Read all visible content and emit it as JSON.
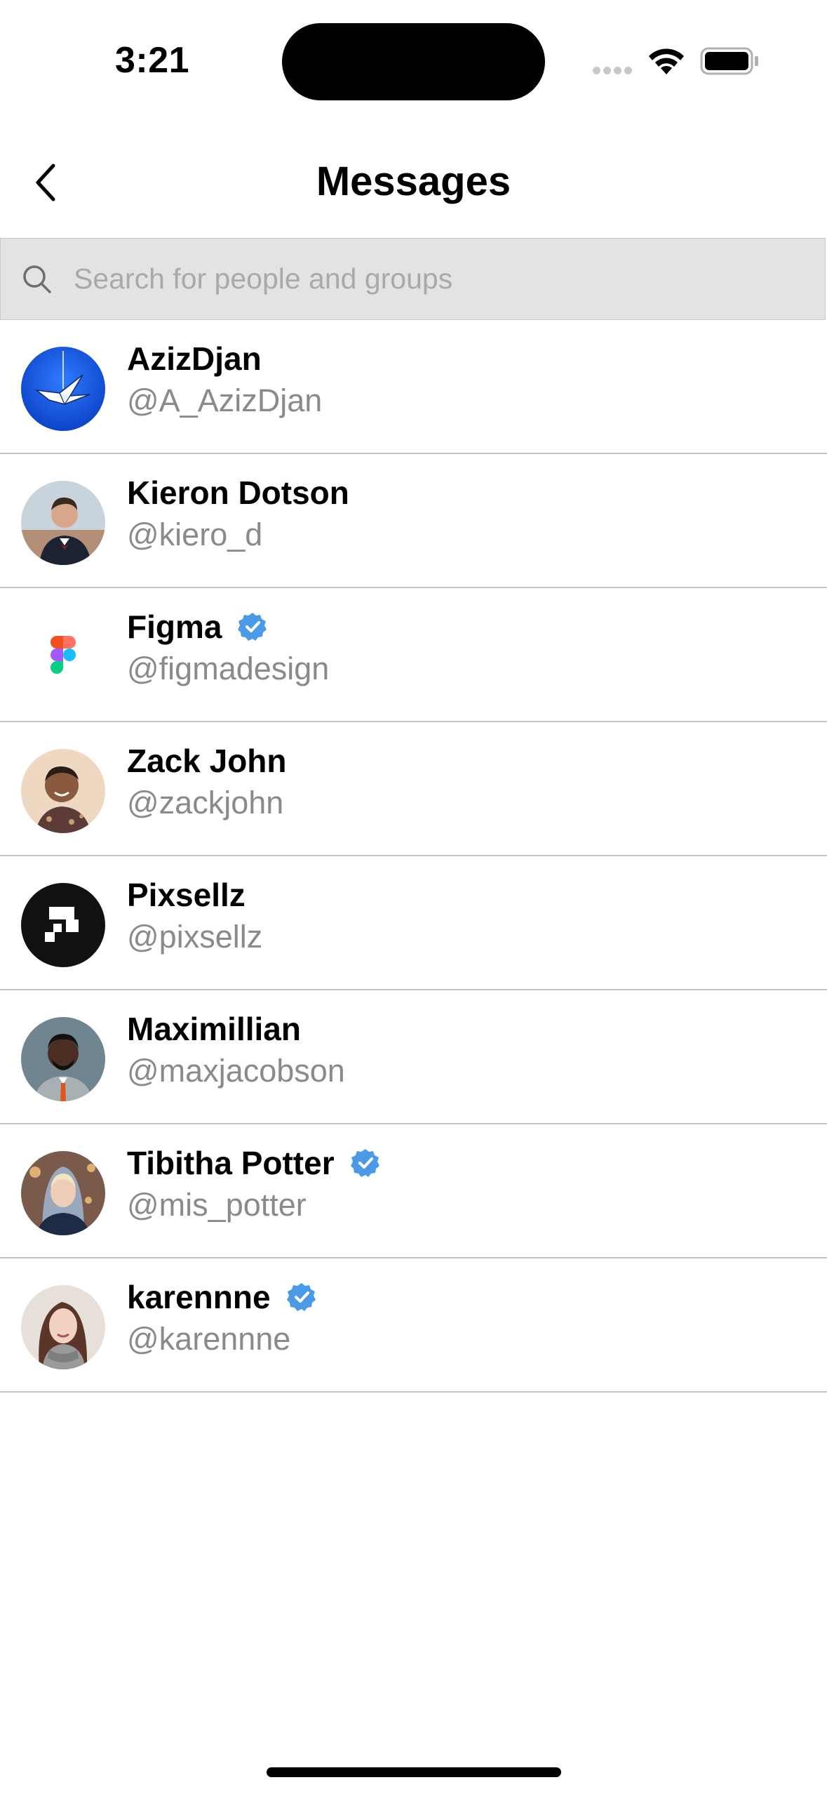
{
  "status": {
    "time": "3:21"
  },
  "header": {
    "title": "Messages"
  },
  "search": {
    "placeholder": "Search for people and groups"
  },
  "contacts": [
    {
      "name": "AzizDjan",
      "handle": "@A_AzizDjan",
      "verified": false,
      "avatar": "paper-crane-logo"
    },
    {
      "name": "Kieron Dotson",
      "handle": "@kiero_d",
      "verified": false,
      "avatar": "person-photo"
    },
    {
      "name": "Figma",
      "handle": "@figmadesign",
      "verified": true,
      "avatar": "figma-logo"
    },
    {
      "name": "Zack John",
      "handle": "@zackjohn",
      "verified": false,
      "avatar": "person-photo"
    },
    {
      "name": "Pixsellz",
      "handle": "@pixsellz",
      "verified": false,
      "avatar": "pixsellz-logo"
    },
    {
      "name": "Maximillian",
      "handle": "@maxjacobson",
      "verified": false,
      "avatar": "person-photo"
    },
    {
      "name": "Tibitha Potter",
      "handle": "@mis_potter",
      "verified": true,
      "avatar": "person-photo"
    },
    {
      "name": "karennne",
      "handle": "@karennne",
      "verified": true,
      "avatar": "person-photo"
    }
  ],
  "colors": {
    "verified": "#4a9ae8",
    "handle": "#8a8a8a",
    "search_bg": "#e3e3e3"
  }
}
